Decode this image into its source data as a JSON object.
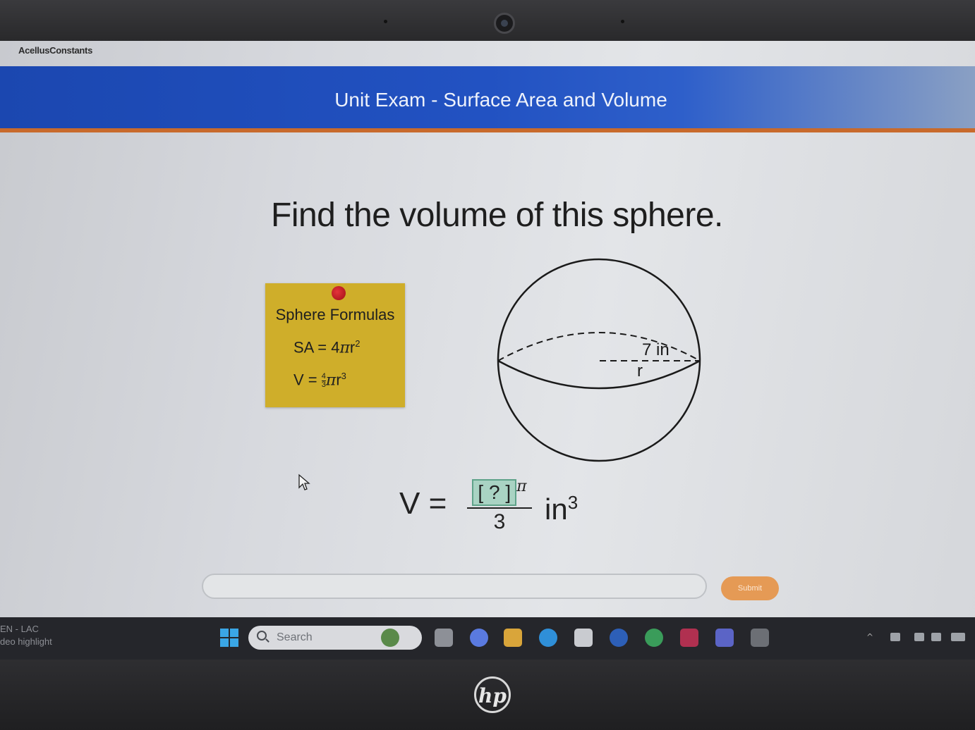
{
  "app": {
    "brand": "AcellusConstants"
  },
  "header": {
    "title": "Unit Exam - Surface Area and Volume"
  },
  "question": {
    "text": "Find the volume of this sphere."
  },
  "formula_card": {
    "title": "Sphere Formulas",
    "sa_lhs": "SA = 4",
    "sa_pi": "π",
    "sa_var": "r",
    "sa_exp": "2",
    "v_lhs": "V = ",
    "v_num": "4",
    "v_den": "3",
    "v_pi": "π",
    "v_var": "r",
    "v_exp": "3",
    "pin_color": "#d42a30"
  },
  "diagram": {
    "radius_label": "7 in",
    "radius_var": "r"
  },
  "expression": {
    "lhs": "V =",
    "placeholder": "[ ? ]",
    "pi": "π",
    "denominator": "3",
    "unit": "in",
    "unit_exp": "3"
  },
  "answer": {
    "value": "",
    "placeholder": ""
  },
  "submit": {
    "label": "Submit",
    "color": "#e59a55"
  },
  "taskbar": {
    "left_line1": "EN - LAC",
    "left_line2": "deo highlight",
    "search_placeholder": "Search",
    "icons": [
      "windows-start-icon",
      "widgets-icon",
      "task-view-icon",
      "copilot-icon",
      "file-explorer-icon",
      "edge-icon",
      "store-icon",
      "hp-support-icon",
      "chrome-icon",
      "mcafee-icon",
      "teams-icon",
      "pen-icon"
    ]
  },
  "colors": {
    "header_blue": "#2252c2",
    "accent_orange": "#c86a2c",
    "note_yellow": "#cfae2a",
    "answer_box": "#a9d3c3"
  }
}
